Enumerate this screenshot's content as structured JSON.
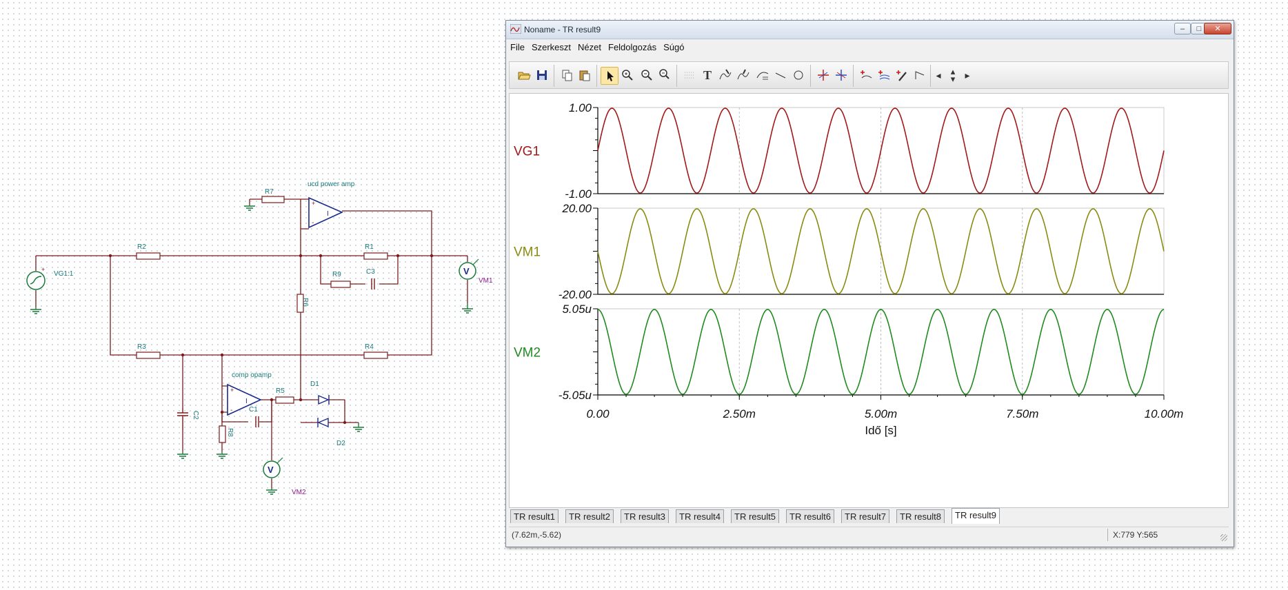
{
  "schematic": {
    "labels": {
      "vg1": "VG1:1",
      "r1": "R1",
      "r2": "R2",
      "r3": "R3",
      "r4": "R4",
      "r5": "R5",
      "r6": "R6",
      "r7": "R7",
      "r8": "R8",
      "r9": "R9",
      "c1": "C1",
      "c2": "C2",
      "c3": "C3",
      "d1": "D1",
      "d2": "D2",
      "vm1": "VM1",
      "vm2": "VM2",
      "ucd": "ucd power amp",
      "comp": "comp opamp",
      "meter_symbol": "V",
      "plus": "+",
      "minus": "-",
      "amp_symbol": "I"
    }
  },
  "window": {
    "title": "Noname - TR result9",
    "controls": {
      "minimize": "–",
      "maximize": "□",
      "close": "✕"
    },
    "menu": [
      "File",
      "Szerkeszt",
      "Nézet",
      "Feldolgozás",
      "Súgó"
    ],
    "toolbar_icons": [
      "open-icon",
      "save-icon",
      "copy-icon",
      "paste-icon",
      "pointer-icon",
      "zoom-in-icon",
      "zoom-out-icon",
      "zoom-100-icon",
      "grid-icon",
      "text-icon",
      "cursor-a-icon",
      "cursor-b-icon",
      "curve-icon",
      "line-icon",
      "circle-icon",
      "marker-a-icon",
      "marker-b-icon",
      "add-curve-icon",
      "add-multi-icon",
      "pen-icon",
      "step-icon",
      "arrow-left-icon",
      "arrow-updown-icon",
      "arrow-right-icon"
    ],
    "toolbar_glyphs": {
      "text": "T",
      "left": "◂",
      "up": "▴",
      "down": "▾",
      "right": "▸"
    },
    "tabs": [
      "TR result1",
      "TR result2",
      "TR result3",
      "TR result4",
      "TR result5",
      "TR result6",
      "TR result7",
      "TR result8",
      "TR result9"
    ],
    "active_tab": "TR result9",
    "status_left": "(7.62m,-5.62)",
    "status_right": "X:779  Y:565"
  },
  "chart_data": {
    "type": "line",
    "xlabel": "Idő [s]",
    "xlim": [
      0,
      0.01
    ],
    "x_ticks": [
      "0.00",
      "2.50m",
      "5.00m",
      "7.50m",
      "10.00m"
    ],
    "grid": "vertical dashed at x ticks",
    "frequency_hz": 1000,
    "panels": [
      {
        "name": "VG1",
        "color": "#a01818",
        "ylim": [
          -1.0,
          1.0
        ],
        "ytick_top": "1.00",
        "ytick_bottom": "-1.00",
        "amplitude": 1.0,
        "phase_at_0": "rising from 0"
      },
      {
        "name": "VM1",
        "color": "#8a8a10",
        "ylim": [
          -20.0,
          20.0
        ],
        "ytick_top": "20.00",
        "ytick_bottom": "-20.00",
        "amplitude": 20.0,
        "phase_at_0": "falling from 0"
      },
      {
        "name": "VM2",
        "color": "#1f8a1f",
        "ylim": [
          -5.05e-06,
          5.05e-06
        ],
        "ytick_top": "5.05u",
        "ytick_bottom": "-5.05u",
        "amplitude": 5.05e-06,
        "phase_at_0": "at maximum"
      }
    ]
  }
}
